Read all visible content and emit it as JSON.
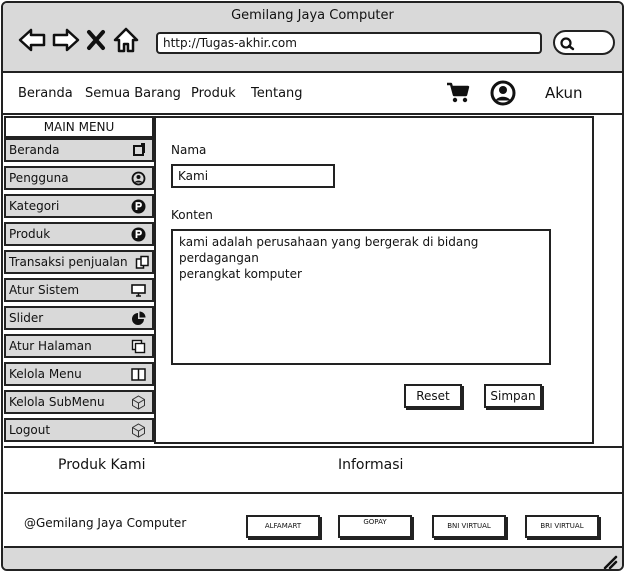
{
  "window": {
    "title": "Gemilang Jaya Computer",
    "url": "http://Tugas-akhir.com"
  },
  "browser_icons": [
    "back-arrow-icon",
    "forward-arrow-icon",
    "close-x-icon",
    "home-icon",
    "search-icon"
  ],
  "topnav": {
    "links": [
      "Beranda",
      "Semua Barang",
      "Produk",
      "Tentang"
    ],
    "account_label": "Akun"
  },
  "sidebar": {
    "header": "MAIN MENU",
    "items": [
      {
        "label": "Beranda",
        "icon": "square-icon"
      },
      {
        "label": "Pengguna",
        "icon": "user-circle-icon"
      },
      {
        "label": "Kategori",
        "icon": "p-circle-icon"
      },
      {
        "label": "Produk",
        "icon": "p-circle-icon"
      },
      {
        "label": "Transaksi penjualan",
        "icon": "copy-icon"
      },
      {
        "label": "Atur Sistem",
        "icon": "monitor-icon"
      },
      {
        "label": "Slider",
        "icon": "pie-icon"
      },
      {
        "label": "Atur Halaman",
        "icon": "pages-icon"
      },
      {
        "label": "Kelola Menu",
        "icon": "columns-icon"
      },
      {
        "label": "Kelola SubMenu",
        "icon": "cube-icon"
      },
      {
        "label": "Logout",
        "icon": "cube-icon"
      }
    ]
  },
  "form": {
    "nama_label": "Nama",
    "nama_value": "Kami",
    "konten_label": "Konten",
    "konten_value": "kami adalah perusahaan yang bergerak di bidang\nperdagangan\nperangkat komputer",
    "reset_label": "Reset",
    "simpan_label": "Simpan"
  },
  "footer": {
    "produk_heading": "Produk Kami",
    "informasi_heading": "Informasi",
    "copyright": "@Gemilang Jaya Computer",
    "payments": [
      "ALFAMART",
      "GOPAY",
      "BNI VIRTUAL",
      "BRI VIRTUAL"
    ]
  },
  "colors": {
    "chrome_gray": "#d9d9d9",
    "border": "#222222"
  }
}
